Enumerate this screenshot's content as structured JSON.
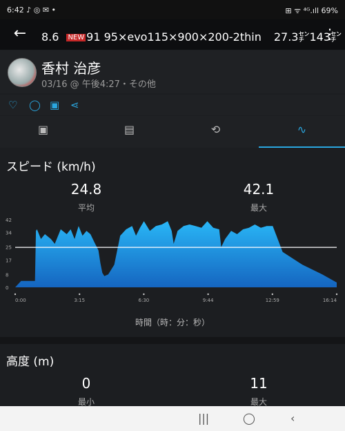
{
  "status": {
    "time": "6:42",
    "notif": "♪ ◎ ✉ •",
    "right": "⊞ ᯤ ⁴ᴳ.ıll 69%"
  },
  "appbar": {
    "num": "8.6",
    "new": "NEW",
    "title": "91 95×evo115×900×200-2thin",
    "stat1": "27.3㌢",
    "stat2": "143㌢",
    "more": "⋮"
  },
  "profile": {
    "name": "香村 治彦",
    "meta": "03/16 @ 午後4:27・その他"
  },
  "tabs": [
    "▣",
    "▤",
    "⟲",
    "∿"
  ],
  "speed": {
    "title": "スピード (km/h)",
    "avg_value": "24.8",
    "avg_label": "平均",
    "max_value": "42.1",
    "max_label": "最大",
    "xlabel": "時間（時：分：秒）"
  },
  "chart_data": {
    "type": "area",
    "x_ticks": [
      "0:00",
      "3:15",
      "6:30",
      "9:44",
      "12:59",
      "16:14"
    ],
    "y_ticks": [
      "0",
      "8",
      "17",
      "25",
      "34",
      "42"
    ],
    "ylim": [
      0,
      42
    ],
    "xlim": [
      0,
      16.23
    ],
    "avg_line": 24.8,
    "x": [
      0,
      0.3,
      0.7,
      1.0,
      1.05,
      1.1,
      1.3,
      1.5,
      1.8,
      2.0,
      2.3,
      2.6,
      2.8,
      3.0,
      3.2,
      3.4,
      3.6,
      3.8,
      4.0,
      4.2,
      4.3,
      4.4,
      4.5,
      4.7,
      5.0,
      5.3,
      5.6,
      5.9,
      6.1,
      6.3,
      6.5,
      6.8,
      7.1,
      7.4,
      7.7,
      7.9,
      8.0,
      8.2,
      8.5,
      8.8,
      9.1,
      9.4,
      9.7,
      10.0,
      10.3,
      10.4,
      10.6,
      10.9,
      11.2,
      11.5,
      11.8,
      12.1,
      12.4,
      12.7,
      12.9,
      13.0,
      13.5,
      14.5,
      15.5,
      16.23
    ],
    "y": [
      0,
      4,
      4,
      4,
      35,
      36,
      30,
      33,
      30,
      27,
      36,
      33,
      36,
      30,
      38,
      32,
      35,
      33,
      28,
      23,
      15,
      9,
      7,
      8,
      14,
      32,
      36,
      38,
      32,
      37,
      41,
      35,
      38,
      39,
      41,
      35,
      27,
      35,
      38,
      39,
      38,
      37,
      41,
      37,
      36,
      25,
      30,
      35,
      33,
      36,
      37,
      39,
      37,
      38,
      38,
      38,
      22,
      14,
      8,
      3
    ]
  },
  "altitude": {
    "title": "高度 (m)",
    "min_value": "0",
    "min_label": "最小",
    "max_value": "11",
    "max_label": "最大"
  },
  "nav": {
    "recent": "|||",
    "home": "◯",
    "back": "‹"
  }
}
